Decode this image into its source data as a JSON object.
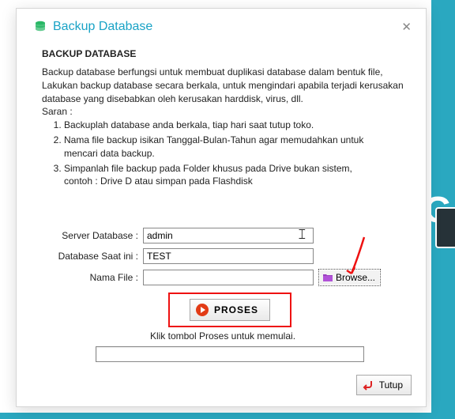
{
  "dialog": {
    "title": "Backup Database",
    "section_head": "BACKUP DATABASE",
    "desc": {
      "l1": "Backup database berfungsi untuk membuat duplikasi database dalam bentuk file,",
      "l2": "Lakukan backup database secara berkala, untuk mengindari apabila terjadi kerusakan",
      "l3": "database yang disebabkan oleh kerusakan harddisk, virus, dll.",
      "l4": "Saran :",
      "o1": "Backuplah database anda berkala, tiap hari saat tutup toko.",
      "o2": "Nama file backup isikan Tanggal-Bulan-Tahun agar memudahkan untuk",
      "o2b": "mencari data backup.",
      "o3": "Simpanlah file backup pada Folder khusus pada Drive bukan sistem,",
      "o3b": "contoh : Drive D atau simpan pada Flashdisk"
    },
    "form": {
      "server_label": "Server Database :",
      "server_value": "admin",
      "db_label": "Database Saat ini :",
      "db_value": "TEST",
      "file_label": "Nama File :",
      "file_value": "",
      "browse_label": "Browse..."
    },
    "proses_label": "PROSES",
    "hint": "Klik tombol Proses untuk memulai.",
    "close_label": "Tutup"
  }
}
